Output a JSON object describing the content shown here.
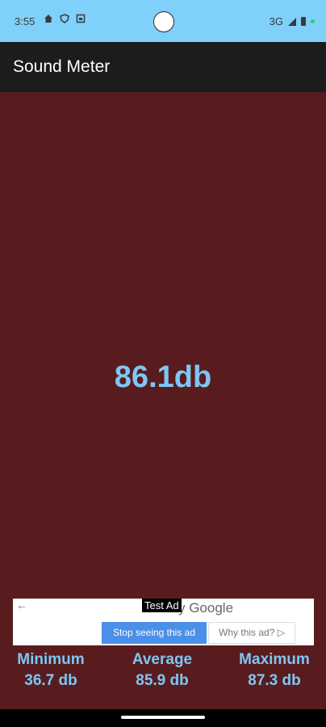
{
  "status_bar": {
    "time": "3:55",
    "left_icons": [
      "home-icon",
      "shield-icon",
      "app-icon"
    ],
    "network": "3G"
  },
  "app_bar": {
    "title": "Sound Meter"
  },
  "meter": {
    "reading": "86.1db"
  },
  "ad": {
    "test_label": "Test Ad",
    "google_text": "y Google",
    "stop_button": "Stop seeing this ad",
    "why_button": "Why this ad? ▷",
    "back_glyph": "←"
  },
  "stats": {
    "minimum": {
      "label": "Minimum",
      "value": "36.7 db"
    },
    "average": {
      "label": "Average",
      "value": "85.9 db"
    },
    "maximum": {
      "label": "Maximum",
      "value": "87.3 db"
    }
  },
  "colors": {
    "status_bar_bg": "#7fd0fb",
    "app_bar_bg": "#1c1c1c",
    "main_bg": "#581c1e",
    "accent_text": "#7fc6f4",
    "ad_button": "#4a8fe8"
  }
}
